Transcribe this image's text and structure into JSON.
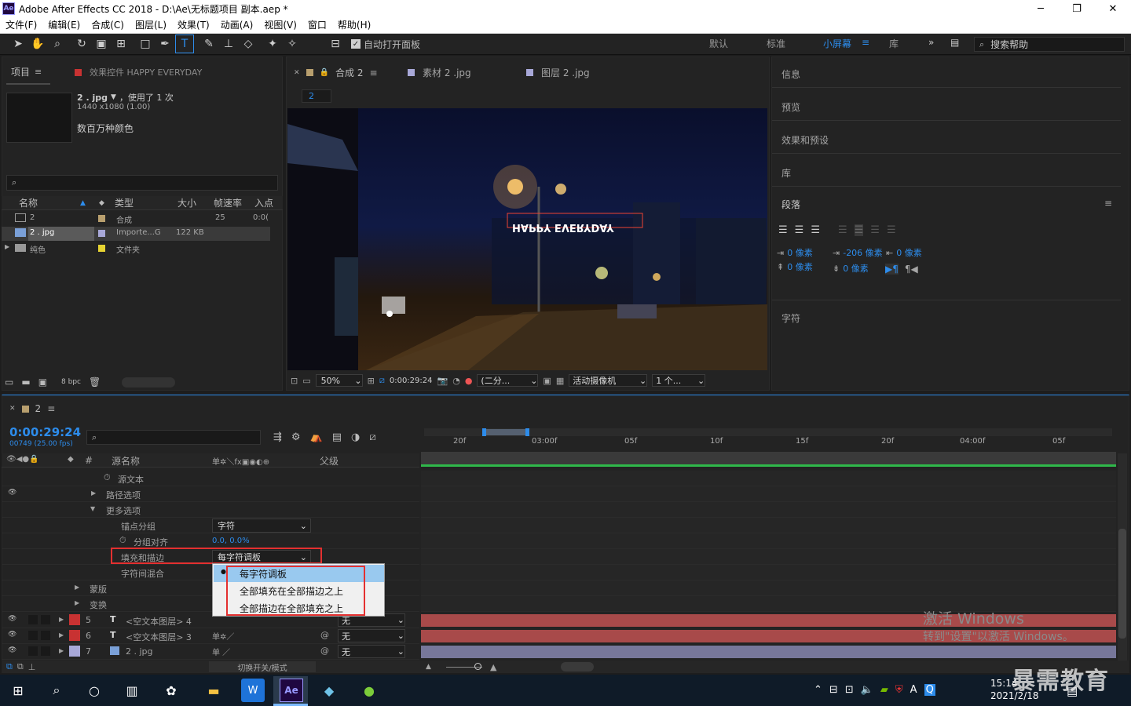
{
  "window": {
    "title": "Adobe After Effects CC 2018 - D:\\Ae\\无标题项目 副本.aep *",
    "app_icon": "Ae",
    "min": "─",
    "max": "❐",
    "close": "✕"
  },
  "menu": [
    "文件(F)",
    "编辑(E)",
    "合成(C)",
    "图层(L)",
    "效果(T)",
    "动画(A)",
    "视图(V)",
    "窗口",
    "帮助(H)"
  ],
  "toolbar": {
    "auto_open": "自动打开面板",
    "search_placeholder": "搜索帮助"
  },
  "workspaces": [
    "默认",
    "标准",
    "小屏幕",
    "库"
  ],
  "project": {
    "tab": "项目",
    "effects_tab": "效果控件 HAPPY EVERYDAY",
    "file_name": "2 . jpg",
    "used": "，使用了 1 次",
    "dimensions": "1440 x1080 (1.00)",
    "colors": "数百万种颜色",
    "columns": [
      "名称",
      "类型",
      "大小",
      "帧速率",
      "入点"
    ],
    "rows": [
      {
        "name": "2",
        "type": "合成",
        "size": "",
        "fps": "25",
        "in": "0:0(",
        "color": "#b89f6e"
      },
      {
        "name": "2 . jpg",
        "type": "Importe...G",
        "size": "122 KB",
        "fps": "",
        "in": "",
        "color": "#a8a8d8"
      },
      {
        "name": "纯色",
        "type": "文件夹",
        "size": "",
        "fps": "",
        "in": "",
        "color": "#e6d332"
      }
    ],
    "bpc": "8 bpc"
  },
  "viewer": {
    "tabs": [
      "合成 2",
      "素材 2 .jpg",
      "图层 2 .jpg"
    ],
    "comp_label": "2",
    "zoom": "50%",
    "time": "0:00:29:24",
    "resolution": "(二分...",
    "camera": "活动摄像机",
    "views": "1 个..."
  },
  "right_panels": [
    "信息",
    "预览",
    "效果和预设",
    "库"
  ],
  "paragraph": {
    "title": "段落",
    "indent_left": "0 像素",
    "indent_first": "-206 像素",
    "indent_right": "0 像素",
    "space_before": "0 像素",
    "space_after": "0 像素"
  },
  "character": {
    "title": "字符"
  },
  "timeline": {
    "tab": "2",
    "timecode": "0:00:29:24",
    "frames": "00749 (25.00 fps)",
    "col_name": "源名称",
    "col_parent": "父级",
    "ruler": [
      "20f",
      "03:00f",
      "05f",
      "10f",
      "15f",
      "20f",
      "04:00f",
      "05f"
    ],
    "props": {
      "source_text": "源文本",
      "path_options": "路径选项",
      "more_options": "更多选项",
      "anchor_group": "锚点分组",
      "anchor_group_value": "字符",
      "group_align": "分组对齐",
      "group_align_value": "0.0, 0.0%",
      "fill_stroke": "填充和描边",
      "fill_stroke_value": "每字符调板",
      "inter_blend": "字符间混合",
      "masks": "蒙版",
      "transform": "变换"
    },
    "dropdown_options": [
      "每字符调板",
      "全部填充在全部描边之上",
      "全部描边在全部填充之上"
    ],
    "layers": [
      {
        "num": "5",
        "type": "T",
        "name": "<空文本图层> 4",
        "parent": "无",
        "color": "#c83232"
      },
      {
        "num": "6",
        "type": "T",
        "name": "<空文本图层> 3",
        "parent": "无",
        "color": "#c83232"
      },
      {
        "num": "7",
        "type": "img",
        "name": "2 . jpg",
        "parent": "无",
        "color": "#a8a8d8"
      }
    ],
    "footer": "切换开关/模式"
  },
  "watermark": {
    "line1": "激活 Windows",
    "line2": "转到\"设置\"以激活 Windows。",
    "brand": "暴需教育"
  },
  "taskbar": {
    "time": "15:14",
    "date": "2021/2/18",
    "ime": "A"
  }
}
